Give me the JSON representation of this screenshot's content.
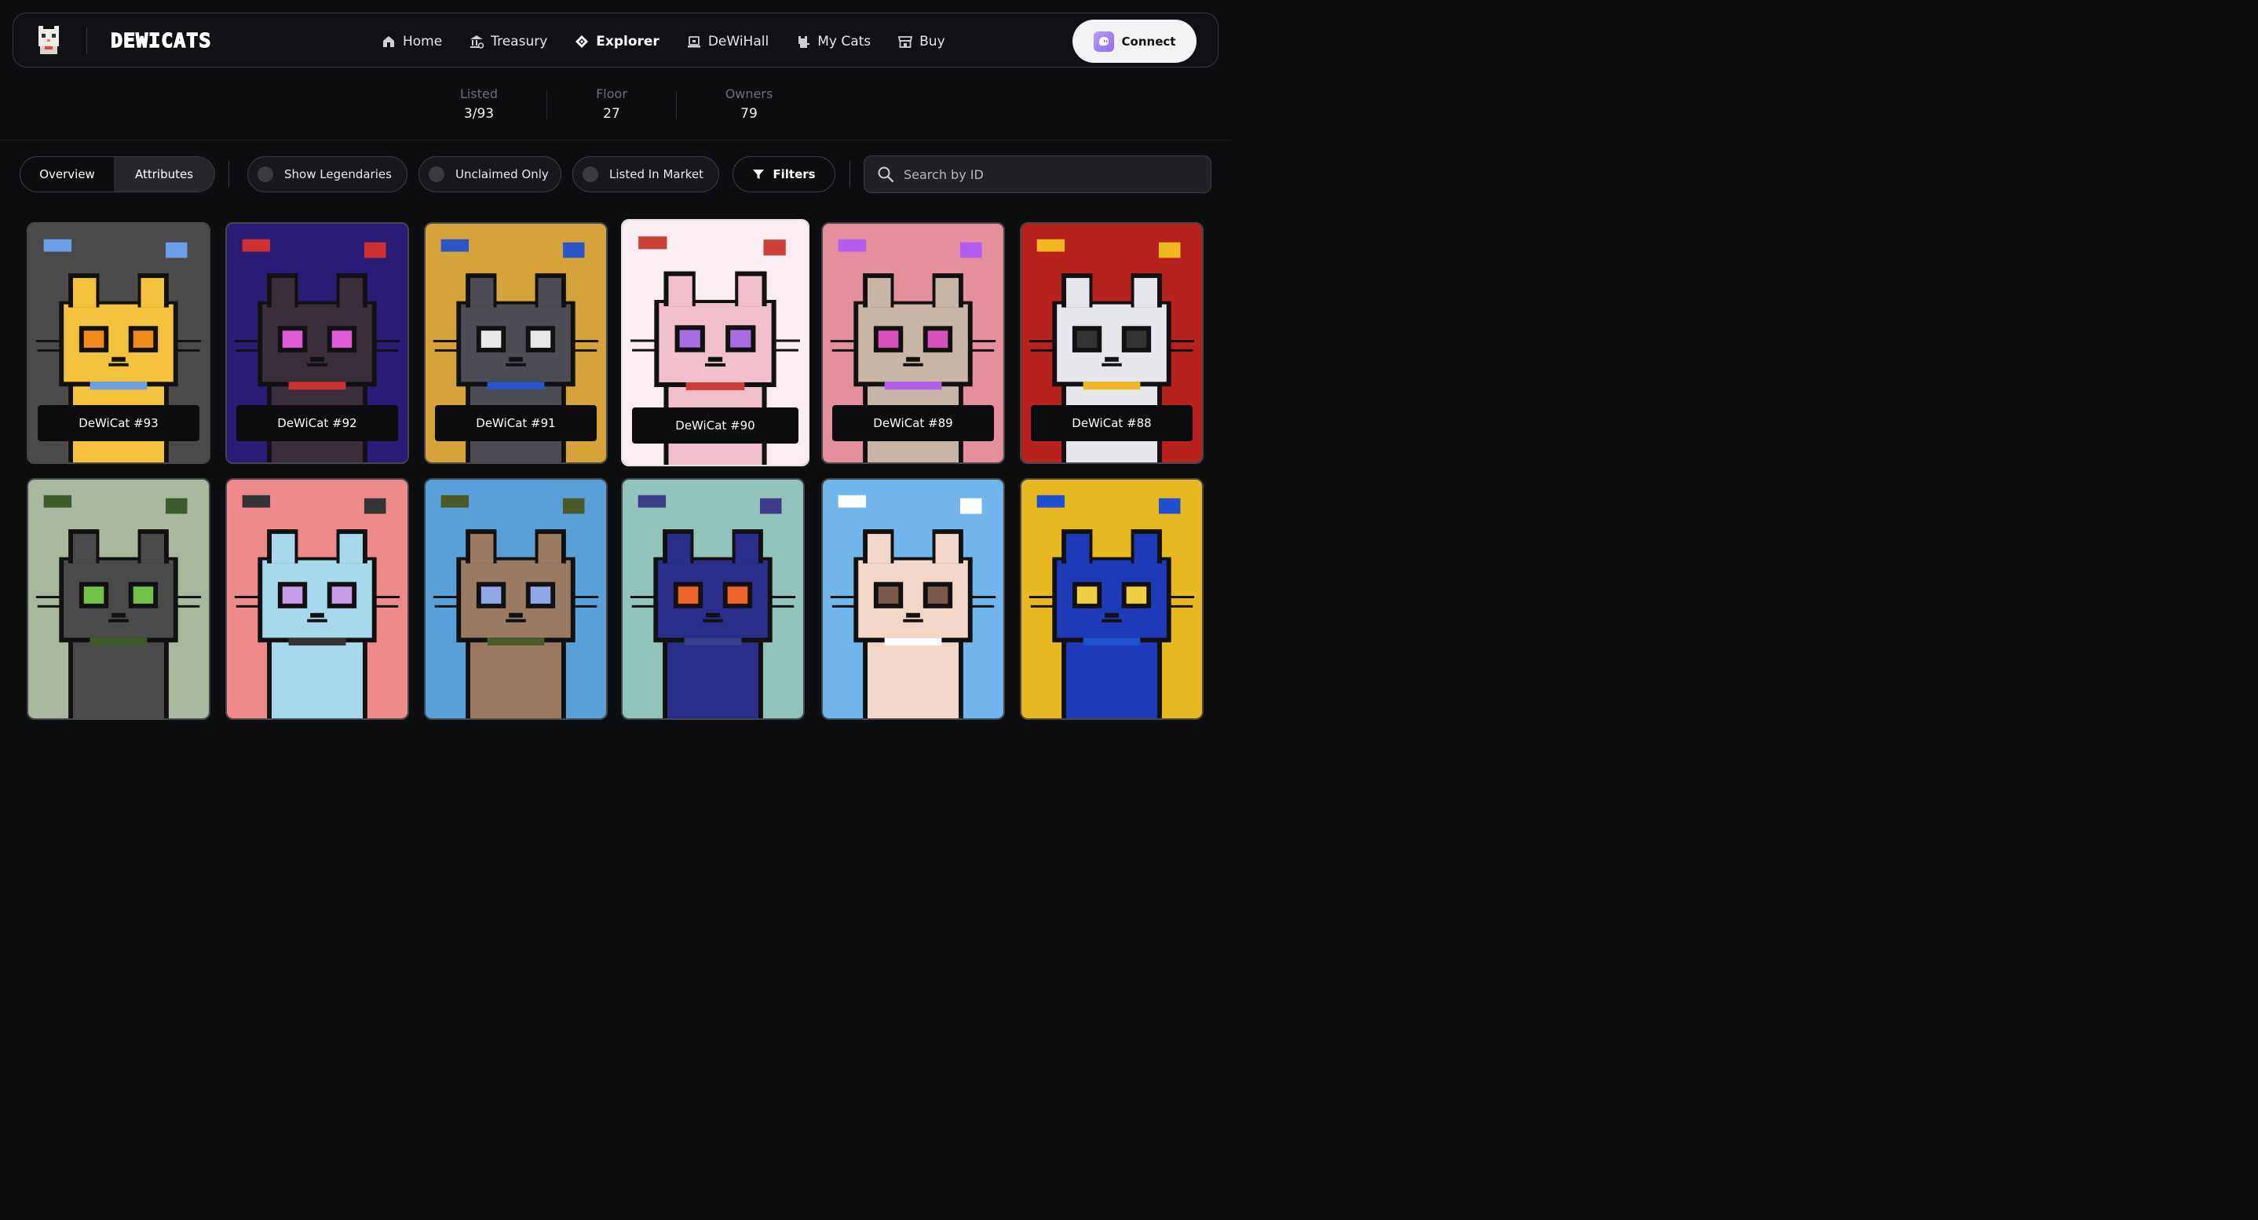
{
  "brand": {
    "wordmark": "DEWICATS",
    "logo_icon": "cat-logo-icon"
  },
  "nav": {
    "items": [
      {
        "label": "Home",
        "icon": "home-icon",
        "active": false
      },
      {
        "label": "Treasury",
        "icon": "bank-icon",
        "active": false
      },
      {
        "label": "Explorer",
        "icon": "diamond-icon",
        "active": true
      },
      {
        "label": "DeWiHall",
        "icon": "hall-icon",
        "active": false
      },
      {
        "label": "My Cats",
        "icon": "cat-icon",
        "active": false
      },
      {
        "label": "Buy",
        "icon": "store-icon",
        "active": false
      }
    ],
    "connect_label": "Connect"
  },
  "stats": [
    {
      "label": "Listed",
      "value": "3/93"
    },
    {
      "label": "Floor",
      "value": "27"
    },
    {
      "label": "Owners",
      "value": "79"
    }
  ],
  "toolbar": {
    "tabs": [
      "Overview",
      "Attributes"
    ],
    "selected_tab": "Attributes",
    "toggles": [
      "Show Legendaries",
      "Unclaimed Only",
      "Listed In Market"
    ],
    "filters_label": "Filters",
    "search_placeholder": "Search by ID"
  },
  "cards": [
    {
      "name": "DeWiCat #93",
      "bg": "#4a4a4a",
      "fur": "#f4c23c",
      "eye": "#f08a1c",
      "accent": "#6aa0e8"
    },
    {
      "name": "DeWiCat #92",
      "bg": "#2a1b77",
      "fur": "#3a2e3a",
      "eye": "#e25ad6",
      "accent": "#d03030"
    },
    {
      "name": "DeWiCat #91",
      "bg": "#d6a33a",
      "fur": "#4c4c55",
      "eye": "#e8e8e8",
      "accent": "#2a56c8"
    },
    {
      "name": "DeWiCat #90",
      "bg": "#fbeef2",
      "fur": "#f2bfcc",
      "eye": "#a56ee0",
      "accent": "#c84038"
    },
    {
      "name": "DeWiCat #89",
      "bg": "#e48e9e",
      "fur": "#c9b4a8",
      "eye": "#d850b8",
      "accent": "#b25cf0"
    },
    {
      "name": "DeWiCat #88",
      "bg": "#b8221e",
      "fur": "#e6e6ec",
      "eye": "#333",
      "accent": "#f0b820"
    },
    {
      "name": "",
      "bg": "#a9b79e",
      "fur": "#4a4a4a",
      "eye": "#72c24a",
      "accent": "#3e5a2a"
    },
    {
      "name": "",
      "bg": "#ee8b8a",
      "fur": "#a8d8ec",
      "eye": "#c79ae8",
      "accent": "#333"
    },
    {
      "name": "",
      "bg": "#5aa0d8",
      "fur": "#9a7a60",
      "eye": "#8ea8e8",
      "accent": "#4c5a2a"
    },
    {
      "name": "",
      "bg": "#93c4bc",
      "fur": "#2b2d8a",
      "eye": "#f0642a",
      "accent": "#3a3e8a"
    },
    {
      "name": "",
      "bg": "#70b6ea",
      "fur": "#f2d6c8",
      "eye": "#7a5a48",
      "accent": "#ffffff"
    },
    {
      "name": "",
      "bg": "#e8b820",
      "fur": "#1e3ab8",
      "eye": "#f0d040",
      "accent": "#2050d0"
    }
  ]
}
